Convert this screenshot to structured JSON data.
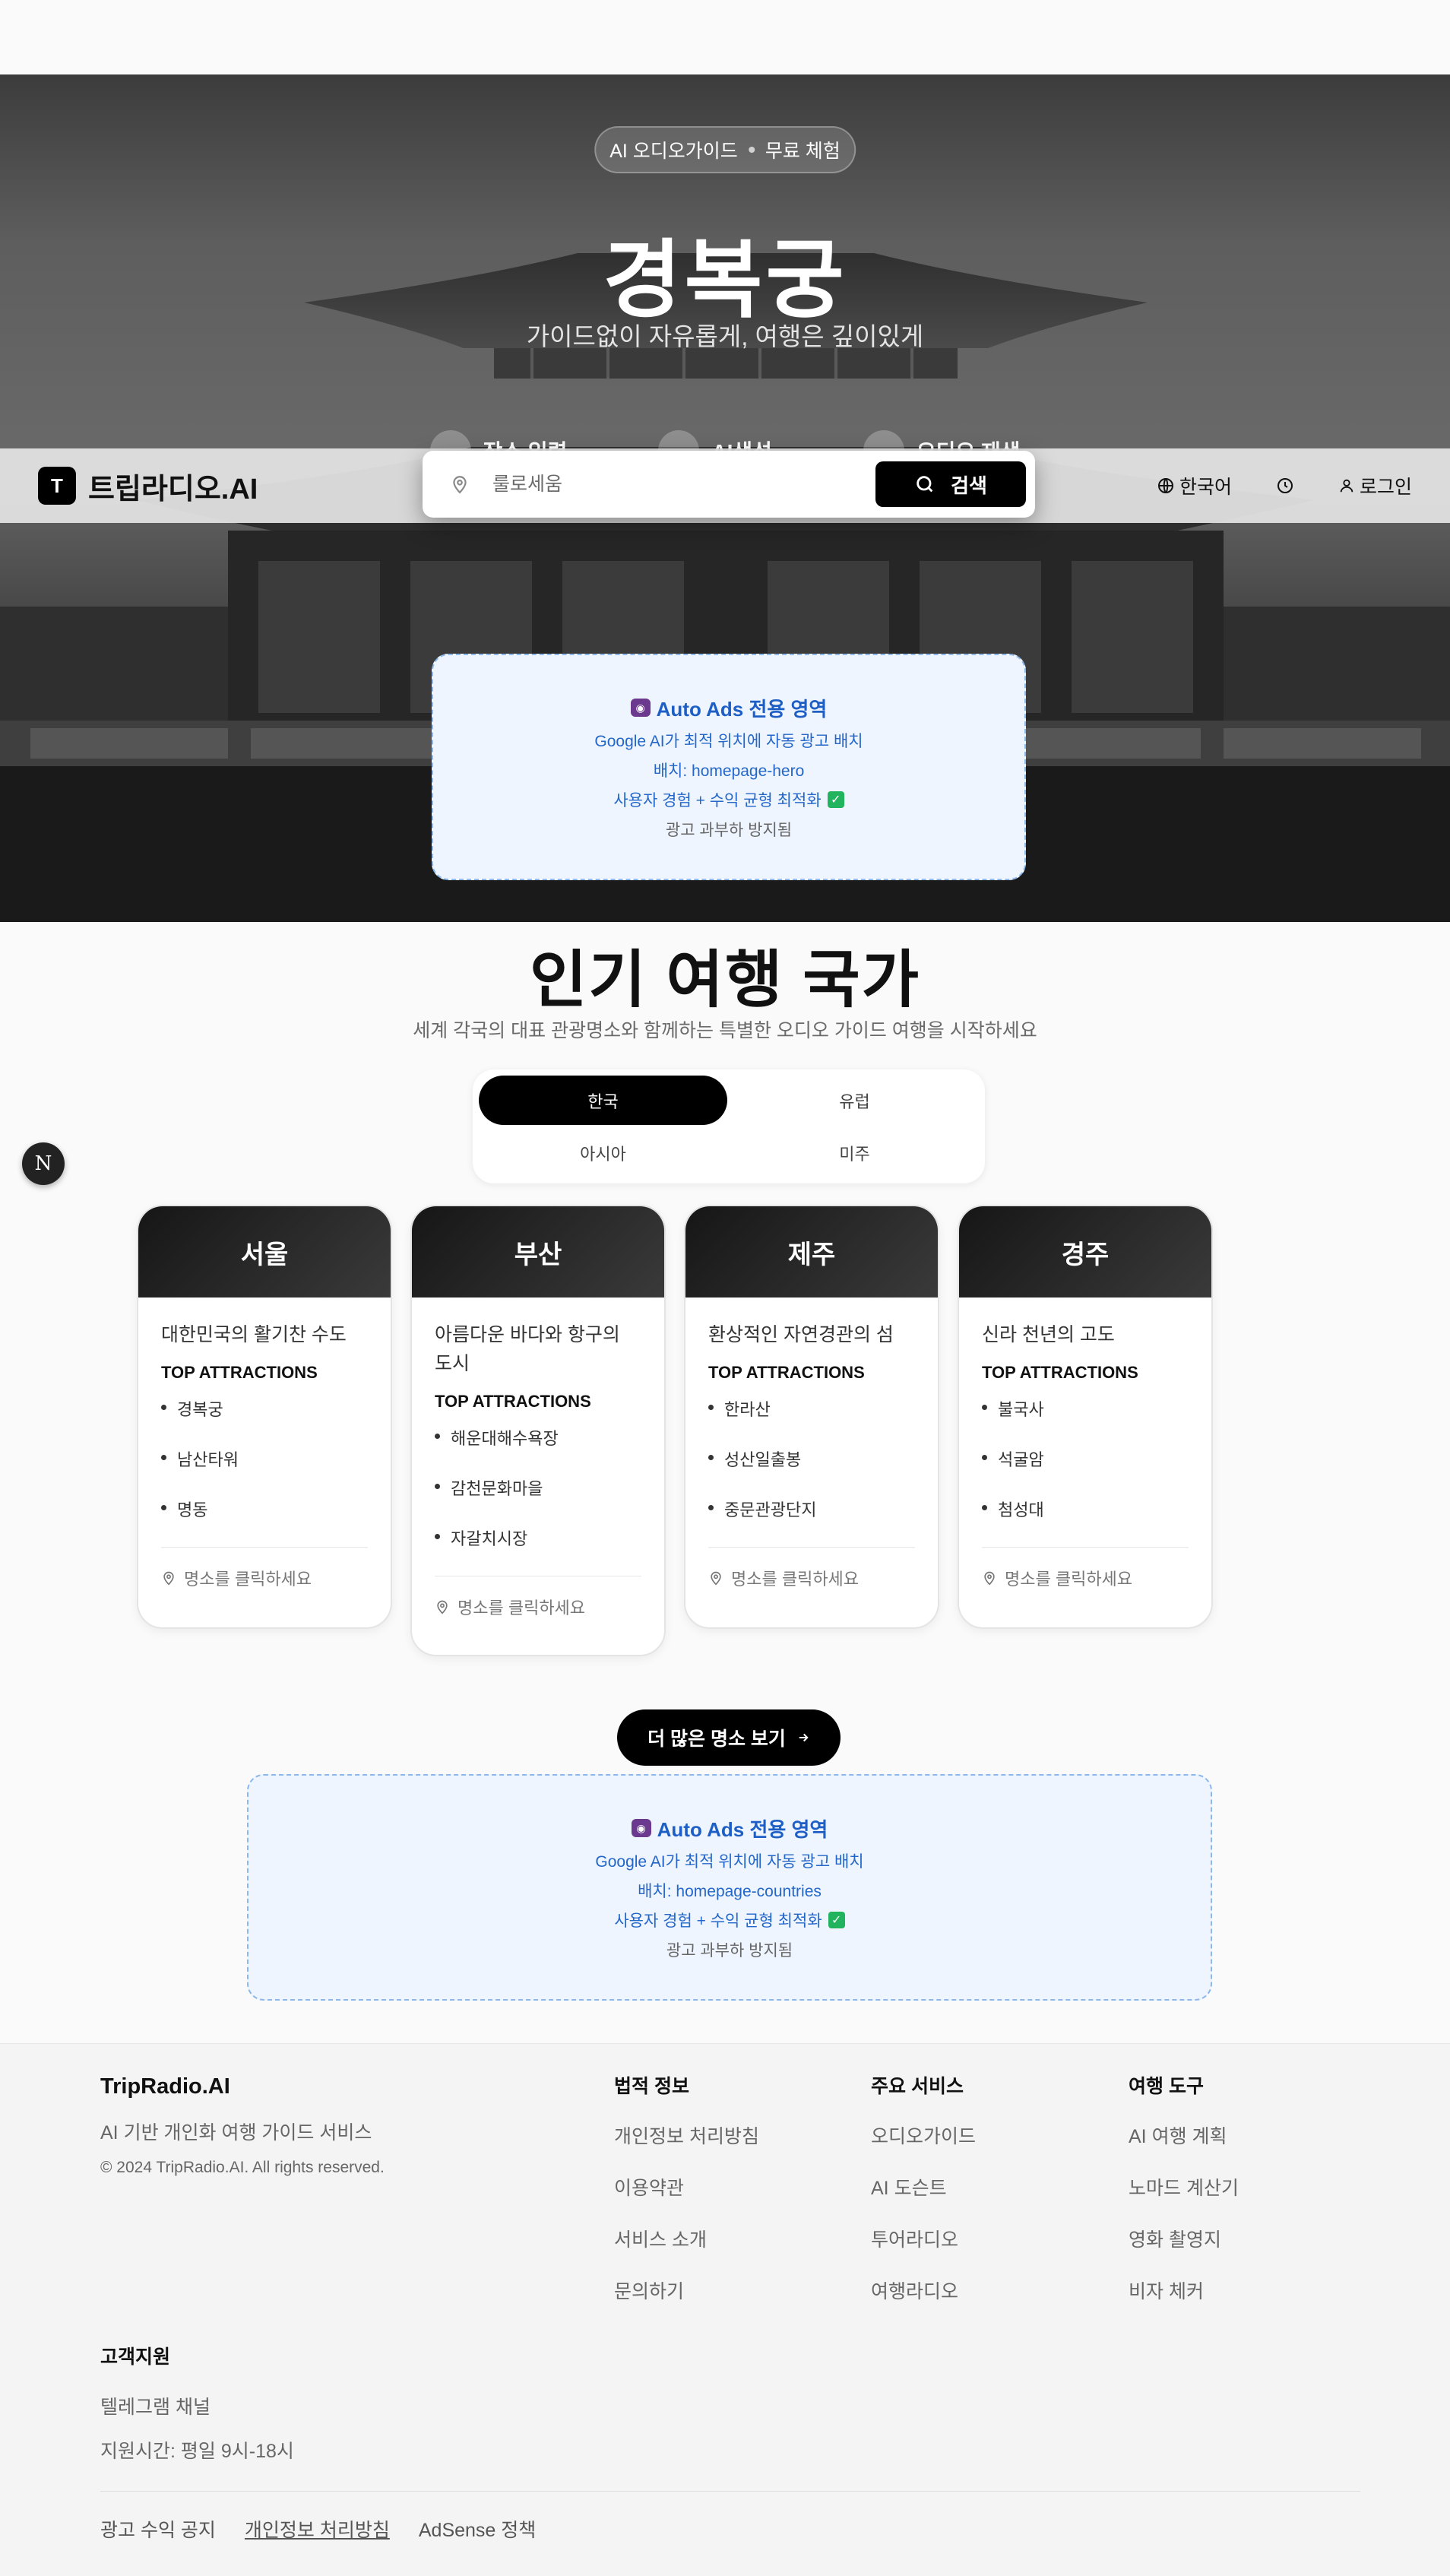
{
  "hero": {
    "badge_left": "AI 오디오가이드",
    "badge_right": "무료 체험",
    "title": "경복궁",
    "subtitle": "가이드없이 자유롭게, 여행은 깊이있게",
    "features": [
      "장소 입력",
      "AI생성",
      "오디오 재생"
    ]
  },
  "header": {
    "logo_letter": "T",
    "logo_text": "트립라디오.AI",
    "language": "한국어",
    "login": "로그인",
    "icons": [
      "globe-icon",
      "clock-icon",
      "user-icon"
    ]
  },
  "search": {
    "placeholder": "룰로세움",
    "button_label": "검색"
  },
  "ad_hero": {
    "title": "Auto Ads 전용 영역",
    "line1": "Google AI가 최적 위치에 자동 광고 배치",
    "line2": "배치: homepage-hero",
    "line3": "사용자 경험 + 수익 균형 최적화",
    "line4": "광고 과부하 방지됨"
  },
  "countries": {
    "title": "인기 여행 국가",
    "subtitle": "세계 각국의 대표 관광명소와 함께하는 특별한 오디오 가이드 여행을 시작하세요",
    "tabs": [
      {
        "label": "한국",
        "active": true
      },
      {
        "label": "유럽",
        "active": false
      },
      {
        "label": "아시아",
        "active": false
      },
      {
        "label": "미주",
        "active": false
      }
    ],
    "attractions_label": "TOP ATTRACTIONS",
    "footer_hint": "명소를 클릭하세요",
    "cities": [
      {
        "name": "서울",
        "desc": "대한민국의 활기찬 수도",
        "attractions": [
          "경복궁",
          "남산타워",
          "명동"
        ]
      },
      {
        "name": "부산",
        "desc": "아름다운 바다와 항구의 도시",
        "attractions": [
          "해운대해수욕장",
          "감천문화마을",
          "자갈치시장"
        ]
      },
      {
        "name": "제주",
        "desc": "환상적인 자연경관의 섬",
        "attractions": [
          "한라산",
          "성산일출봉",
          "중문관광단지"
        ]
      },
      {
        "name": "경주",
        "desc": "신라 천년의 고도",
        "attractions": [
          "불국사",
          "석굴암",
          "첨성대"
        ]
      }
    ],
    "more_button": "더 많은 명소 보기"
  },
  "ad_countries": {
    "title": "Auto Ads 전용 영역",
    "line1": "Google AI가 최적 위치에 자동 광고 배치",
    "line2": "배치: homepage-countries",
    "line3": "사용자 경험 + 수익 균형 최적화",
    "line4": "광고 과부하 방지됨"
  },
  "floating_badge": "N",
  "footer": {
    "brand": "TripRadio.AI",
    "tagline": "AI 기반 개인화 여행 가이드 서비스",
    "copyright": "© 2024 TripRadio.AI. All rights reserved.",
    "columns": [
      {
        "title": "법적 정보",
        "links": [
          "개인정보 처리방침",
          "이용약관",
          "서비스 소개",
          "문의하기"
        ]
      },
      {
        "title": "주요 서비스",
        "links": [
          "오디오가이드",
          "AI 도슨트",
          "투어라디오",
          "여행라디오"
        ]
      },
      {
        "title": "여행 도구",
        "links": [
          "AI 여행 계획",
          "노마드 계산기",
          "영화 촬영지",
          "비자 체커"
        ]
      }
    ],
    "support": {
      "title": "고객지원",
      "telegram": "텔레그램 채널",
      "hours": "지원시간: 평일 9시-18시"
    },
    "bottom_links": [
      "광고 수익 공지",
      "개인정보 처리방침",
      "AdSense 정책"
    ]
  },
  "colors": {
    "accent": "#000000",
    "ad_bg": "#eef5ff",
    "ad_border": "#8bb7ea",
    "ad_text": "#1d5fc4",
    "check": "#22b35e"
  }
}
